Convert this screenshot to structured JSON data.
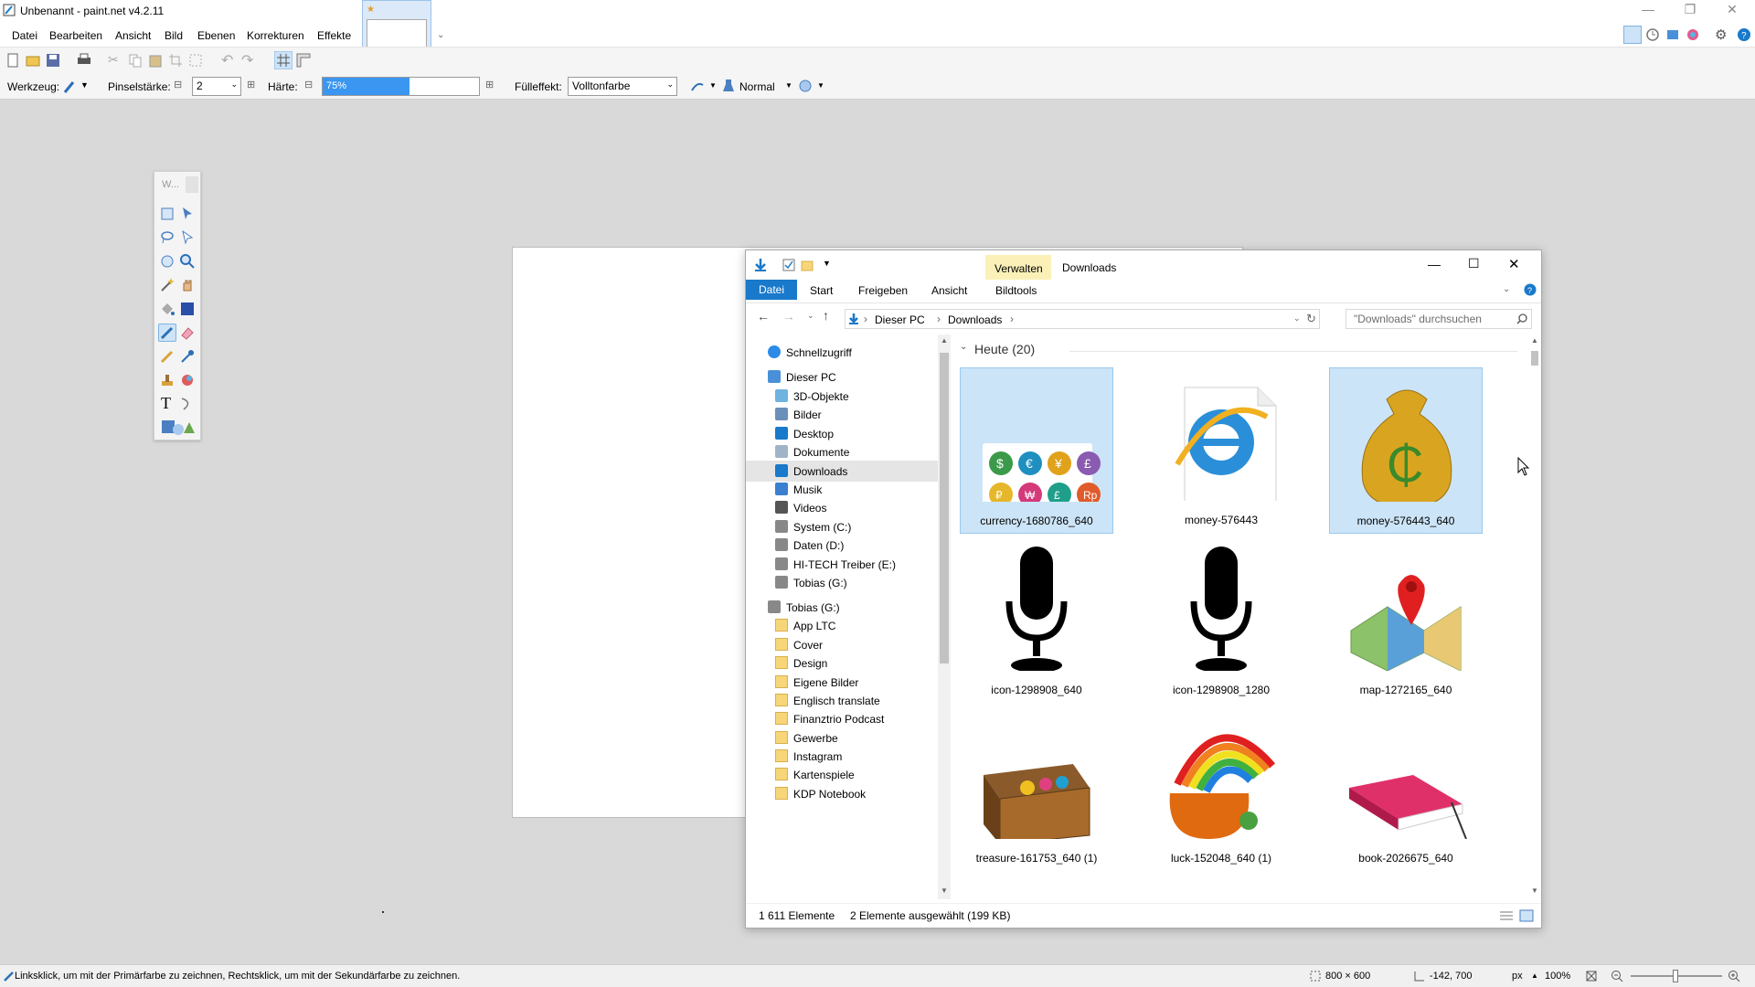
{
  "app": {
    "title": "Unbenannt - paint.net v4.2.11"
  },
  "menu": [
    "Datei",
    "Bearbeiten",
    "Ansicht",
    "Bild",
    "Ebenen",
    "Korrekturen",
    "Effekte"
  ],
  "toolbar": {
    "werkzeug_label": "Werkzeug:",
    "pinselstaerke_label": "Pinselstärke:",
    "pinselstaerke_value": "2",
    "haerte_label": "Härte:",
    "haerte_value": "75%",
    "haerte_fraction": 0.75,
    "fuelleffekt_label": "Fülleffekt:",
    "fuelleffekt_value": "Volltonfarbe",
    "blend_mode": "Normal"
  },
  "tools_window": {
    "title": "W..."
  },
  "explorer": {
    "context_tab": "Verwalten",
    "window_title": "Downloads",
    "ribbon_tabs": [
      "Datei",
      "Start",
      "Freigeben",
      "Ansicht",
      "Bildtools"
    ],
    "breadcrumb": [
      "Dieser PC",
      "Downloads"
    ],
    "search_placeholder": "\"Downloads\" durchsuchen",
    "group_header": "Heute (20)",
    "nav": [
      {
        "label": "Schnellzugriff",
        "icon": "star-icon",
        "level": 0
      },
      {
        "label": "Dieser PC",
        "icon": "pc-icon",
        "level": 0
      },
      {
        "label": "3D-Objekte",
        "icon": "cube-icon",
        "level": 1
      },
      {
        "label": "Bilder",
        "icon": "pictures-icon",
        "level": 1
      },
      {
        "label": "Desktop",
        "icon": "desktop-icon",
        "level": 1
      },
      {
        "label": "Dokumente",
        "icon": "documents-icon",
        "level": 1
      },
      {
        "label": "Downloads",
        "icon": "download-icon",
        "level": 1,
        "selected": true
      },
      {
        "label": "Musik",
        "icon": "music-icon",
        "level": 1
      },
      {
        "label": "Videos",
        "icon": "video-icon",
        "level": 1
      },
      {
        "label": "System (C:)",
        "icon": "drive-icon",
        "level": 1
      },
      {
        "label": "Daten (D:)",
        "icon": "drive-icon",
        "level": 1
      },
      {
        "label": "HI-TECH Treiber (E:)",
        "icon": "drive-icon",
        "level": 1
      },
      {
        "label": "Tobias (G:)",
        "icon": "drive-icon",
        "level": 1
      },
      {
        "label": "Tobias (G:)",
        "icon": "drive-icon",
        "level": 0
      },
      {
        "label": "App LTC",
        "icon": "folder-icon",
        "level": 1
      },
      {
        "label": "Cover",
        "icon": "folder-icon",
        "level": 1
      },
      {
        "label": "Design",
        "icon": "folder-icon",
        "level": 1
      },
      {
        "label": "Eigene Bilder",
        "icon": "folder-icon",
        "level": 1
      },
      {
        "label": "Englisch translate",
        "icon": "folder-icon",
        "level": 1
      },
      {
        "label": "Finanztrio Podcast",
        "icon": "folder-icon",
        "level": 1
      },
      {
        "label": "Gewerbe",
        "icon": "folder-icon",
        "level": 1
      },
      {
        "label": "Instagram",
        "icon": "folder-icon",
        "level": 1
      },
      {
        "label": "Kartenspiele",
        "icon": "folder-icon",
        "level": 1
      },
      {
        "label": "KDP Notebook",
        "icon": "folder-icon",
        "level": 1
      }
    ],
    "files": [
      {
        "name": "currency-1680786_640",
        "icon": "currency-icons-thumb",
        "selected": true
      },
      {
        "name": "money-576443",
        "icon": "internet-explorer-file-icon",
        "selected": false
      },
      {
        "name": "money-576443_640",
        "icon": "money-bag-thumb",
        "selected": true
      },
      {
        "name": "icon-1298908_640",
        "icon": "microphone-thumb",
        "selected": false
      },
      {
        "name": "icon-1298908_1280",
        "icon": "microphone-thumb",
        "selected": false
      },
      {
        "name": "map-1272165_640",
        "icon": "map-pin-thumb",
        "selected": false
      },
      {
        "name": "treasure-161753_640 (1)",
        "icon": "treasure-chest-thumb",
        "selected": false
      },
      {
        "name": "luck-152048_640 (1)",
        "icon": "rainbow-pot-thumb",
        "selected": false
      },
      {
        "name": "book-2026675_640",
        "icon": "book-thumb",
        "selected": false
      }
    ],
    "status_count": "1 611 Elemente",
    "status_selection": "2 Elemente ausgewählt (199 KB)"
  },
  "statusbar": {
    "hint": "Linksklick, um mit der Primärfarbe zu zeichnen, Rechtsklick, um mit der Sekundärfarbe zu zeichnen.",
    "image_size": "800 × 600",
    "cursor_pos": "-142, 700",
    "unit": "px",
    "zoom": "100%"
  },
  "colors": {
    "accent": "#1979ca",
    "selection": "#cce4f7",
    "verwalten": "#fbf1b8",
    "slider": "#3a96f0"
  }
}
